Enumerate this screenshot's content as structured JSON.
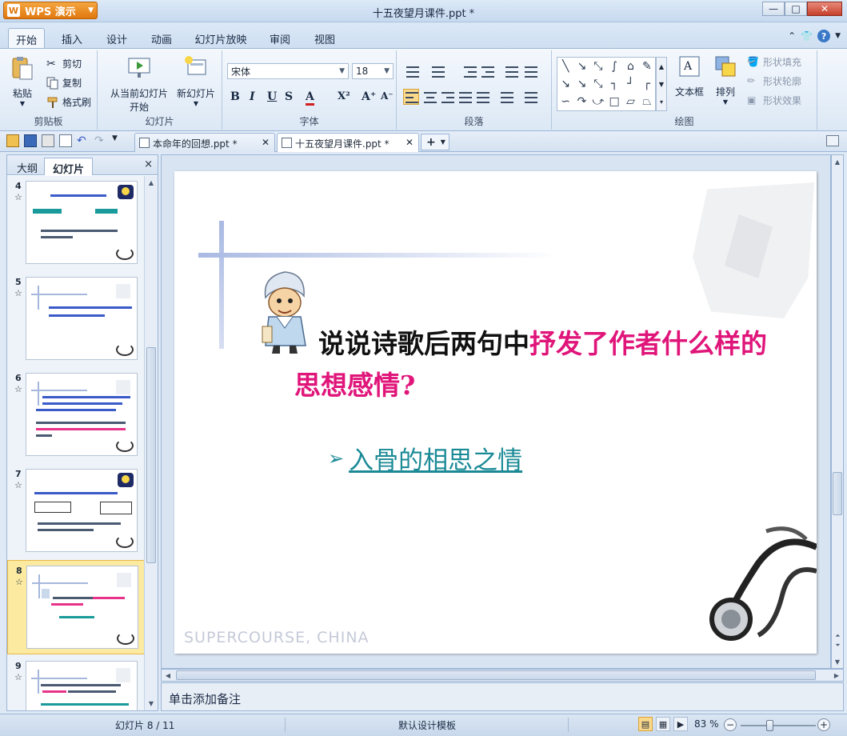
{
  "window": {
    "app_button": "WPS 演示",
    "title": "十五夜望月课件.ppt *"
  },
  "ribbon_tabs": [
    "开始",
    "插入",
    "设计",
    "动画",
    "幻灯片放映",
    "审阅",
    "视图"
  ],
  "ribbon": {
    "clipboard": {
      "paste": "粘贴",
      "cut": "剪切",
      "copy": "复制",
      "format_painter": "格式刷",
      "label": "剪贴板"
    },
    "slides": {
      "from_current_line1": "从当前幻灯片",
      "from_current_line2": "开始",
      "new_slide": "新幻灯片",
      "label": "幻灯片"
    },
    "font": {
      "name": "宋体",
      "size": "18",
      "label": "字体",
      "bold": "B",
      "italic": "I",
      "underline": "U",
      "shadow": "S",
      "color": "A",
      "superscript": "X²",
      "grow": "A⁺",
      "shrink": "A⁻"
    },
    "paragraph": {
      "label": "段落"
    },
    "drawing": {
      "textbox": "文本框",
      "arrange": "排列",
      "shape_fill": "形状填充",
      "shape_outline": "形状轮廓",
      "shape_effect": "形状效果",
      "label": "绘图"
    }
  },
  "doc_tabs": [
    {
      "label": "本命年的回想.ppt *"
    },
    {
      "label": "十五夜望月课件.ppt *"
    }
  ],
  "left_pane": {
    "tab_outline": "大纲",
    "tab_slides": "幻灯片",
    "close": "×",
    "slides": [
      {
        "num": "4",
        "star": "☆"
      },
      {
        "num": "5",
        "star": "☆"
      },
      {
        "num": "6",
        "star": "☆"
      },
      {
        "num": "7",
        "star": "☆"
      },
      {
        "num": "8",
        "star": "☆"
      },
      {
        "num": "9",
        "star": "☆"
      }
    ]
  },
  "slide": {
    "title_black": "说说诗歌后两句中",
    "title_pink": "抒发了作者什么样的思想感情?",
    "bullet_arrow": "➢",
    "bullet_text": "入骨的相思之情",
    "brand": "SUPERCOURSE, CHINA"
  },
  "notes": {
    "placeholder": "单击添加备注"
  },
  "statusbar": {
    "slide_counter": "幻灯片 8 / 11",
    "template": "默认设计模板",
    "zoom": "83 %"
  },
  "colors": {
    "accent_pink": "#e0157a",
    "bullet_teal": "#1a8a96",
    "ribbon_bg": "#dce8f5",
    "app_orange": "#e0780e"
  }
}
